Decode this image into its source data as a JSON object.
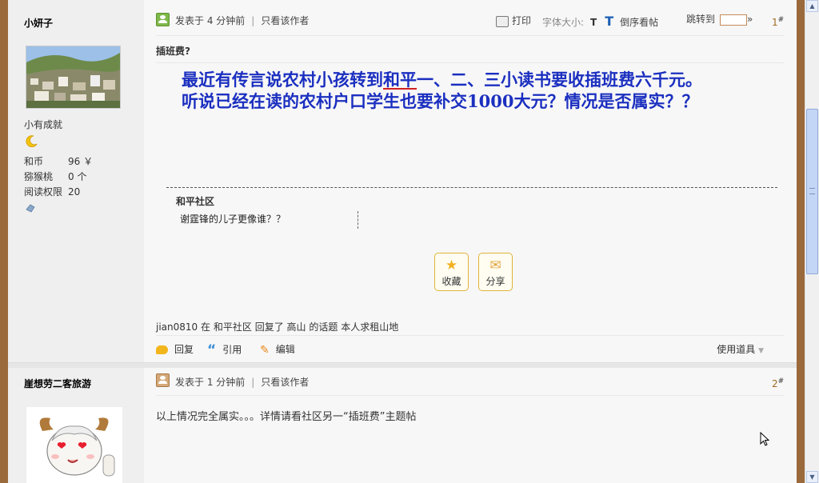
{
  "post1": {
    "author": "小妍子",
    "rank": "小有成就",
    "stats": [
      {
        "label": "和币",
        "value": "96 ￥"
      },
      {
        "label": "猕猴桃",
        "value": "0 个"
      },
      {
        "label": "阅读权限",
        "value": "20"
      }
    ],
    "posted": "发表于  4 分钟前",
    "only_author": "只看该作者",
    "print": "打印",
    "font_size_label": "字体大小:",
    "font_small": "T",
    "font_large": "T",
    "reverse_order": "倒序看帖",
    "jump_to": "跳转到",
    "jump_arrow": "»",
    "floor_num": "1",
    "floor_mark": "#",
    "title": "插班费?",
    "body": {
      "line1a": "最近有传言说农村小孩转到",
      "line1_hl": "和平",
      "line1b": "一、二、三小读书要收插班费六千元。",
      "line2": "听说已经在读的农村户口学生也要补交1000大元？情况是否属实？？"
    },
    "community": "和平社区",
    "related_link": "谢霆锋的儿子更像谁？？",
    "buttons": {
      "favorite": "收藏",
      "share": "分享"
    },
    "activity": {
      "user": "jian0810",
      "in": "在",
      "forum": "和平社区",
      "replied": "回复了",
      "target_user": "高山",
      "topic_of": "的话题",
      "topic": "本人求租山地"
    },
    "actions": {
      "reply": "回复",
      "quote": "引用",
      "edit": "编辑",
      "use_tool": "使用道具"
    }
  },
  "post2": {
    "author": "崖想劳二客旅游",
    "posted": "发表于  1 分钟前",
    "only_author": "只看该作者",
    "floor_num": "2",
    "floor_mark": "#",
    "body": "以上情况完全属实。。。详情请看社区另一“插班费”主题帖"
  },
  "colors": {
    "post_text": "#1b2fc0",
    "accent": "#a06a20",
    "frame": "#9a6a3c"
  },
  "icons": [
    "post-icon",
    "print-icon",
    "star-icon",
    "envelope-icon",
    "reply-icon",
    "quote-icon",
    "edit-icon",
    "moon-icon",
    "cursor-icon"
  ]
}
